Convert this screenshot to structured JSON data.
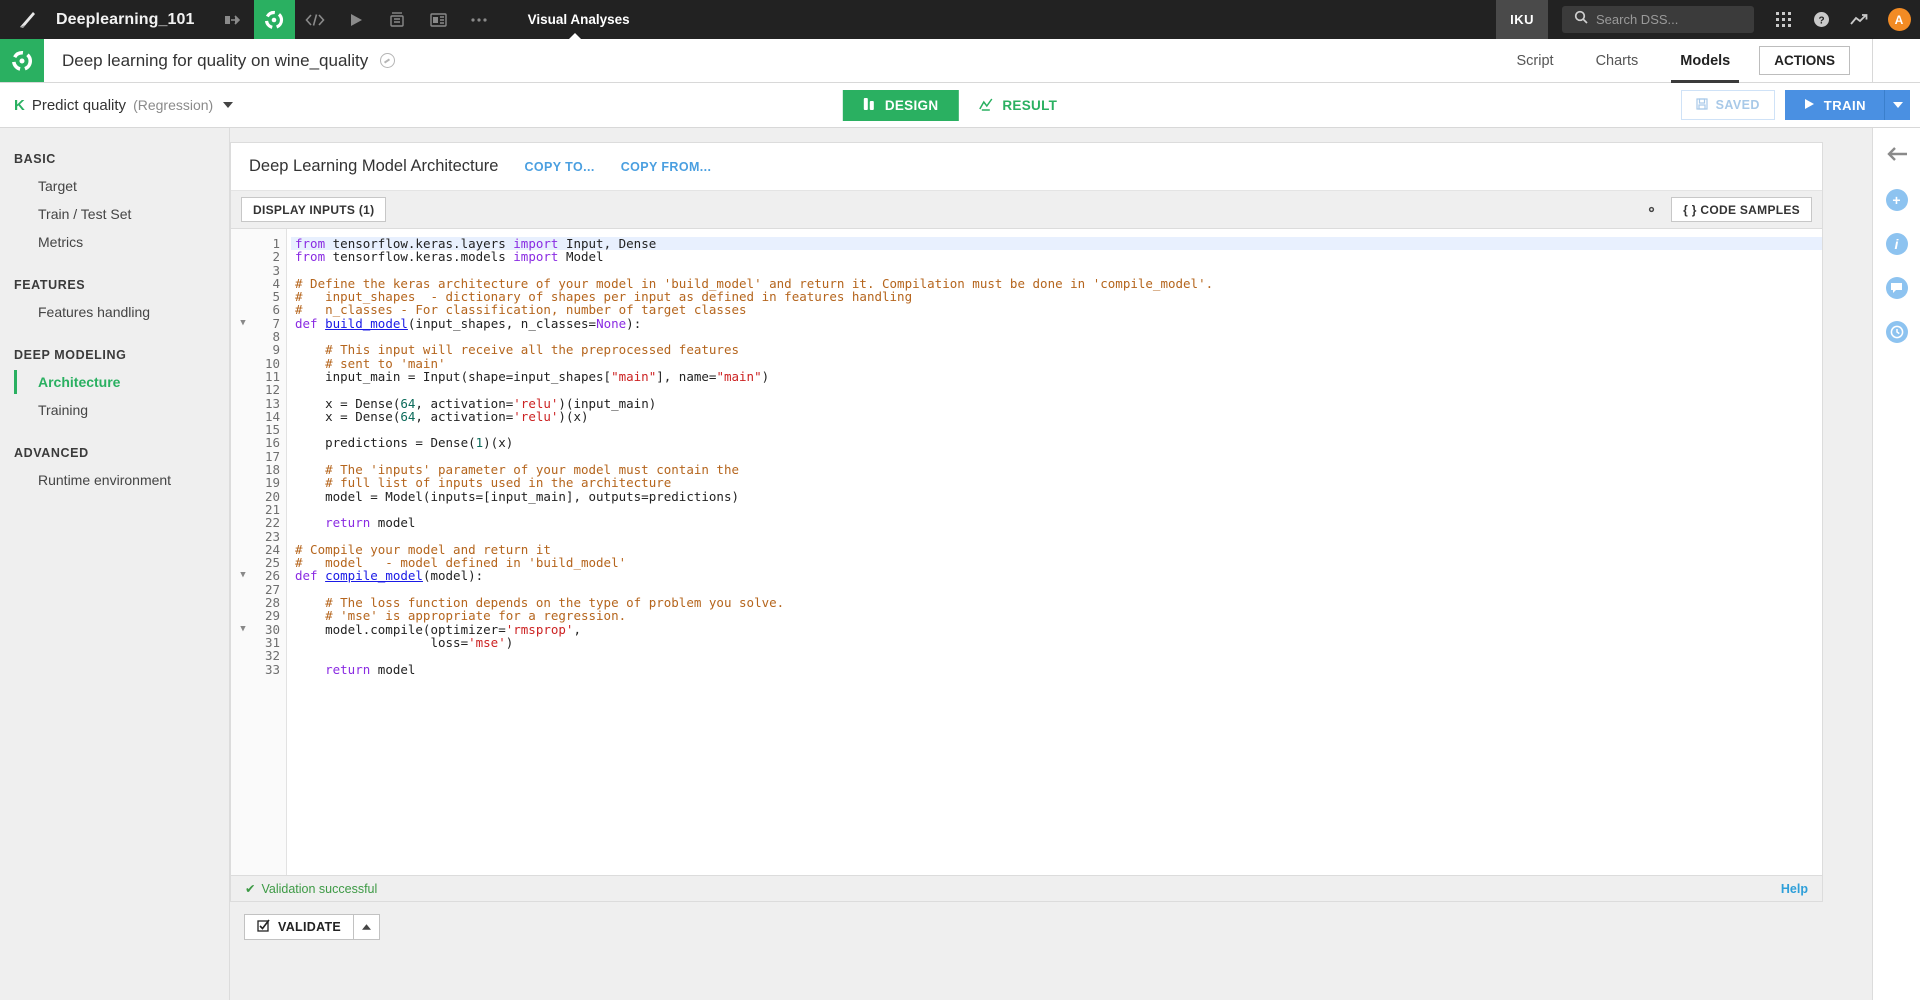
{
  "topbar": {
    "project_name": "Deeplearning_101",
    "section_label": "Visual Analyses",
    "icons": [
      "dss-logo-icon",
      "flow-icon",
      "lab-icon",
      "code-icon",
      "jobs-icon",
      "notebook-icon",
      "dashboard-icon",
      "more-icon"
    ],
    "org_badge": "IKU",
    "search_placeholder": "Search DSS...",
    "search_value": "",
    "avatar_initial": "A",
    "right_icons": [
      "apps-grid-icon",
      "help-icon",
      "activity-icon"
    ]
  },
  "header": {
    "title": "Deep learning for quality on wine_quality",
    "status_icon": "clock-status-icon",
    "tabs": [
      {
        "label": "Script",
        "selected": false
      },
      {
        "label": "Charts",
        "selected": false
      },
      {
        "label": "Models",
        "selected": true
      }
    ],
    "actions_label": "ACTIONS"
  },
  "taskbar": {
    "kind_badge": "K",
    "task_name": "Predict quality",
    "task_type": "(Regression)",
    "tabs": [
      {
        "label": "DESIGN",
        "icon": "flask-icon",
        "active": true
      },
      {
        "label": "RESULT",
        "icon": "chart-line-icon",
        "active": false
      }
    ],
    "saved_label": "SAVED",
    "saved_icon": "floppy-icon",
    "train_label": "TRAIN",
    "train_icon": "play-icon"
  },
  "sidebar": {
    "groups": [
      {
        "title": "BASIC",
        "items": [
          {
            "label": "Target",
            "active": false
          },
          {
            "label": "Train / Test Set",
            "active": false
          },
          {
            "label": "Metrics",
            "active": false
          }
        ]
      },
      {
        "title": "FEATURES",
        "items": [
          {
            "label": "Features handling",
            "active": false
          }
        ]
      },
      {
        "title": "DEEP MODELING",
        "items": [
          {
            "label": "Architecture",
            "active": true
          },
          {
            "label": "Training",
            "active": false
          }
        ]
      },
      {
        "title": "ADVANCED",
        "items": [
          {
            "label": "Runtime environment",
            "active": false
          }
        ]
      }
    ]
  },
  "panel": {
    "title": "Deep Learning Model Architecture",
    "copy_to_label": "COPY TO...",
    "copy_from_label": "COPY FROM...",
    "display_inputs_label": "DISPLAY INPUTS (1)",
    "gear_icon": "gear-icon",
    "code_samples_label": "{ } CODE SAMPLES"
  },
  "editor": {
    "fold_lines": [
      7,
      26,
      30
    ],
    "highlight_line": 1,
    "lines": [
      {
        "n": 1,
        "tokens": [
          {
            "t": "from ",
            "c": "kw"
          },
          {
            "t": "tensorflow.keras.layers ",
            "c": ""
          },
          {
            "t": "import ",
            "c": "kw"
          },
          {
            "t": "Input, Dense",
            "c": ""
          }
        ]
      },
      {
        "n": 2,
        "tokens": [
          {
            "t": "from ",
            "c": "kw"
          },
          {
            "t": "tensorflow.keras.models ",
            "c": ""
          },
          {
            "t": "import ",
            "c": "kw"
          },
          {
            "t": "Model",
            "c": ""
          }
        ]
      },
      {
        "n": 3,
        "tokens": []
      },
      {
        "n": 4,
        "tokens": [
          {
            "t": "# Define the keras architecture of your model in 'build_model' and return it. Compilation must be done in 'compile_model'.",
            "c": "cm"
          }
        ]
      },
      {
        "n": 5,
        "tokens": [
          {
            "t": "#   input_shapes  - dictionary of shapes per input as defined in features handling",
            "c": "cm"
          }
        ]
      },
      {
        "n": 6,
        "tokens": [
          {
            "t": "#   n_classes - For classification, number of target classes",
            "c": "cm"
          }
        ]
      },
      {
        "n": 7,
        "tokens": [
          {
            "t": "def ",
            "c": "kw"
          },
          {
            "t": "build_model",
            "c": "fn"
          },
          {
            "t": "(input_shapes, n_classes=",
            "c": ""
          },
          {
            "t": "None",
            "c": "kw"
          },
          {
            "t": "):",
            "c": ""
          }
        ]
      },
      {
        "n": 8,
        "tokens": []
      },
      {
        "n": 9,
        "tokens": [
          {
            "t": "    # This input will receive all the preprocessed features",
            "c": "cm"
          }
        ]
      },
      {
        "n": 10,
        "tokens": [
          {
            "t": "    # sent to 'main'",
            "c": "cm"
          }
        ]
      },
      {
        "n": 11,
        "tokens": [
          {
            "t": "    input_main = Input(shape=input_shapes[",
            "c": ""
          },
          {
            "t": "\"main\"",
            "c": "st"
          },
          {
            "t": "], name=",
            "c": ""
          },
          {
            "t": "\"main\"",
            "c": "st"
          },
          {
            "t": ")",
            "c": ""
          }
        ]
      },
      {
        "n": 12,
        "tokens": []
      },
      {
        "n": 13,
        "tokens": [
          {
            "t": "    x = Dense(",
            "c": ""
          },
          {
            "t": "64",
            "c": "num"
          },
          {
            "t": ", activation=",
            "c": ""
          },
          {
            "t": "'relu'",
            "c": "st"
          },
          {
            "t": ")(input_main)",
            "c": ""
          }
        ]
      },
      {
        "n": 14,
        "tokens": [
          {
            "t": "    x = Dense(",
            "c": ""
          },
          {
            "t": "64",
            "c": "num"
          },
          {
            "t": ", activation=",
            "c": ""
          },
          {
            "t": "'relu'",
            "c": "st"
          },
          {
            "t": ")(x)",
            "c": ""
          }
        ]
      },
      {
        "n": 15,
        "tokens": []
      },
      {
        "n": 16,
        "tokens": [
          {
            "t": "    predictions = Dense(",
            "c": ""
          },
          {
            "t": "1",
            "c": "num"
          },
          {
            "t": ")(x)",
            "c": ""
          }
        ]
      },
      {
        "n": 17,
        "tokens": []
      },
      {
        "n": 18,
        "tokens": [
          {
            "t": "    # The 'inputs' parameter of your model must contain the",
            "c": "cm"
          }
        ]
      },
      {
        "n": 19,
        "tokens": [
          {
            "t": "    # full list of inputs used in the architecture",
            "c": "cm"
          }
        ]
      },
      {
        "n": 20,
        "tokens": [
          {
            "t": "    model = Model(inputs=[input_main], outputs=predictions)",
            "c": ""
          }
        ]
      },
      {
        "n": 21,
        "tokens": []
      },
      {
        "n": 22,
        "tokens": [
          {
            "t": "    ",
            "c": ""
          },
          {
            "t": "return ",
            "c": "kw"
          },
          {
            "t": "model",
            "c": ""
          }
        ]
      },
      {
        "n": 23,
        "tokens": []
      },
      {
        "n": 24,
        "tokens": [
          {
            "t": "# Compile your model and return it",
            "c": "cm"
          }
        ]
      },
      {
        "n": 25,
        "tokens": [
          {
            "t": "#   model   - model defined in 'build_model'",
            "c": "cm"
          }
        ]
      },
      {
        "n": 26,
        "tokens": [
          {
            "t": "def ",
            "c": "kw"
          },
          {
            "t": "compile_model",
            "c": "fn"
          },
          {
            "t": "(model):",
            "c": ""
          }
        ]
      },
      {
        "n": 27,
        "tokens": []
      },
      {
        "n": 28,
        "tokens": [
          {
            "t": "    # The loss function depends on the type of problem you solve.",
            "c": "cm"
          }
        ]
      },
      {
        "n": 29,
        "tokens": [
          {
            "t": "    # 'mse' is appropriate for a regression.",
            "c": "cm"
          }
        ]
      },
      {
        "n": 30,
        "tokens": [
          {
            "t": "    model.compile(optimizer=",
            "c": ""
          },
          {
            "t": "'rmsprop'",
            "c": "st"
          },
          {
            "t": ",",
            "c": ""
          }
        ]
      },
      {
        "n": 31,
        "tokens": [
          {
            "t": "                  loss=",
            "c": ""
          },
          {
            "t": "'mse'",
            "c": "st"
          },
          {
            "t": ")",
            "c": ""
          }
        ]
      },
      {
        "n": 32,
        "tokens": []
      },
      {
        "n": 33,
        "tokens": [
          {
            "t": "    ",
            "c": ""
          },
          {
            "t": "return ",
            "c": "kw"
          },
          {
            "t": "model",
            "c": ""
          }
        ]
      }
    ]
  },
  "statusbar": {
    "validation_message": "Validation successful",
    "validation_icon": "check-icon",
    "help_label": "Help"
  },
  "bottom": {
    "validate_label": "VALIDATE",
    "validate_icon": "checkbox-icon"
  },
  "rightrail": {
    "back_icon": "arrow-left-icon",
    "items": [
      "add-icon",
      "info-icon",
      "comment-icon",
      "history-icon"
    ]
  },
  "colors": {
    "green": "#2ab061",
    "blue": "#4a90e2",
    "link_blue": "#4a9fe0",
    "orange": "#f28b24",
    "dark": "#222222"
  }
}
